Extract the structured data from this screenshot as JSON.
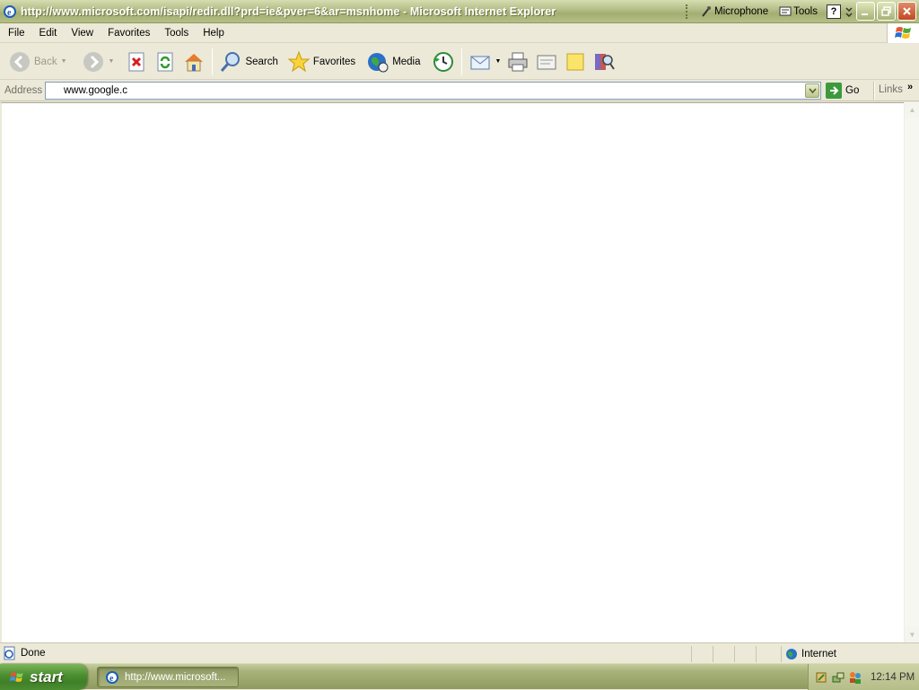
{
  "window": {
    "title": "http://www.microsoft.com/isapi/redir.dll?prd=ie&pver=6&ar=msnhome - Microsoft Internet Explorer"
  },
  "langbar": {
    "microphone_label": "Microphone",
    "tools_label": "Tools"
  },
  "menu": [
    "File",
    "Edit",
    "View",
    "Favorites",
    "Tools",
    "Help"
  ],
  "toolbar": {
    "back_label": "Back",
    "search_label": "Search",
    "favorites_label": "Favorites",
    "media_label": "Media"
  },
  "address": {
    "label": "Address",
    "value": "www.google.c",
    "go_label": "Go",
    "links_label": "Links"
  },
  "status": {
    "text": "Done",
    "zone": "Internet"
  },
  "taskbar": {
    "start_label": "start",
    "task_label": "http://www.microsoft...",
    "clock": "12:14 PM"
  },
  "icons": {
    "ie": "internet-explorer-icon",
    "back": "back-arrow-icon",
    "forward": "forward-arrow-icon",
    "stop": "stop-icon",
    "refresh": "refresh-icon",
    "home": "home-icon",
    "search": "magnifier-icon",
    "favorites": "star-icon",
    "media": "media-globe-icon",
    "history": "history-icon",
    "mail": "mail-icon",
    "print": "printer-icon",
    "edit": "edit-icon",
    "discuss": "note-icon",
    "research": "research-icon"
  },
  "colors": {
    "titlebar": "#a3ae72",
    "taskbar": "#9aa56c",
    "start": "#4d9132",
    "close": "#c04a22"
  }
}
